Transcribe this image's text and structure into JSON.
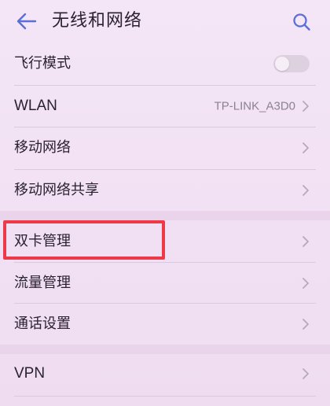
{
  "header": {
    "title": "无线和网络",
    "back_icon": "arrow-left-icon",
    "search_icon": "search-icon"
  },
  "settings": {
    "airplane_mode": {
      "label": "飞行模式",
      "toggle_on": false
    },
    "wlan": {
      "label": "WLAN",
      "value": "TP-LINK_A3D0"
    },
    "mobile_network": {
      "label": "移动网络"
    },
    "tethering": {
      "label": "移动网络共享"
    },
    "dual_sim": {
      "label": "双卡管理",
      "highlighted": true
    },
    "data_usage": {
      "label": "流量管理"
    },
    "call_settings": {
      "label": "通话设置"
    },
    "vpn": {
      "label": "VPN"
    }
  },
  "colors": {
    "accent": "#5b6fd6",
    "highlight": "#ee3a48",
    "background": "#f2e3f4",
    "text": "#2a2230",
    "secondary_text": "#8c8290"
  }
}
